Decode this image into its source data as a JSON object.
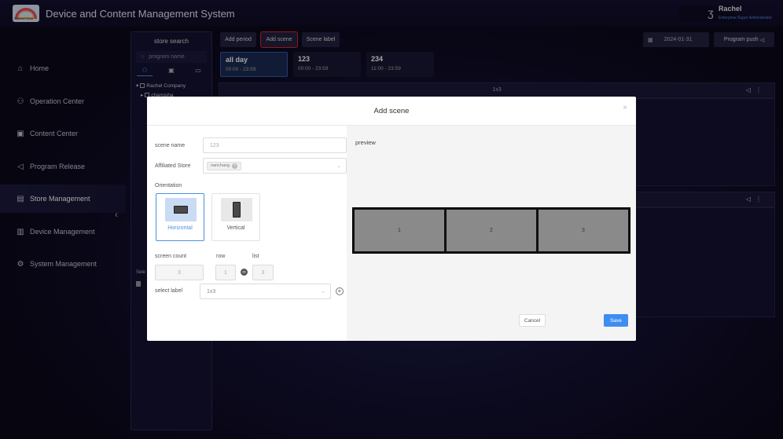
{
  "header": {
    "logo_text": "Rainbow Cloud",
    "title": "Device and Content Management System",
    "user_name": "Rachel",
    "user_role": "Enterprise Super Administrator"
  },
  "sidebar": {
    "items": [
      {
        "label": "Home",
        "icon": "home-icon"
      },
      {
        "label": "Operation Center",
        "icon": "operation-icon"
      },
      {
        "label": "Content Center",
        "icon": "content-icon"
      },
      {
        "label": "Program Release",
        "icon": "send-icon"
      },
      {
        "label": "Store Management",
        "icon": "store-icon",
        "active": true
      },
      {
        "label": "Device Management",
        "icon": "device-icon"
      },
      {
        "label": "System Management",
        "icon": "gear-icon"
      }
    ]
  },
  "store_panel": {
    "title": "store search",
    "search_placeholder": "program name",
    "tree": [
      "Rachel Company",
      "changsha"
    ],
    "selected_label": "Sele"
  },
  "toolbar": {
    "add_period": "Add period",
    "add_scene": "Add scene",
    "scene_label": "Scene label",
    "date": "2024-01-31",
    "program_push": "Program push"
  },
  "periods": [
    {
      "name": "all day",
      "range": "00:00 - 23:59",
      "active": true
    },
    {
      "name": "123",
      "range": "00:00 - 23:59"
    },
    {
      "name": "234",
      "range": "11:00 - 23:59"
    }
  ],
  "scene_cards": [
    {
      "label": "1x3"
    },
    {
      "label": ""
    }
  ],
  "modal": {
    "title": "Add scene",
    "close": "×",
    "scene_name_label": "scene name",
    "scene_name_placeholder": "123",
    "store_label": "Affiliated Store",
    "store_tag": "nanchang",
    "orientation_label": "Orientation",
    "horizontal": "Horizontal",
    "vertical": "Vertical",
    "screen_count_label": "screen count",
    "row_label": "row",
    "list_label": "list",
    "screen_count": "3",
    "row": "1",
    "list": "3",
    "select_label": "select label",
    "select_value": "1x3",
    "preview_title": "preview",
    "screens": [
      "1",
      "2",
      "3"
    ],
    "cancel": "Cancel",
    "save": "Save"
  }
}
